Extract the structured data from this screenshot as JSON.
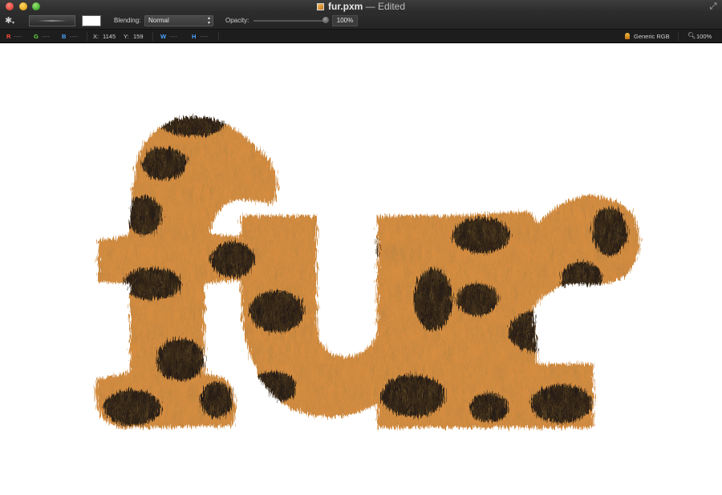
{
  "window": {
    "file_name": "fur.pxm",
    "separator": "—",
    "status": "Edited"
  },
  "toolbar": {
    "blending_label": "Blending:",
    "blending_value": "Normal",
    "opacity_label": "Opacity:",
    "opacity_value": "100%",
    "swatch_color": "#ffffff"
  },
  "infobar": {
    "r_label": "R",
    "g_label": "G",
    "b_label": "B",
    "dash": "----",
    "x_label": "X:",
    "x_value": "1145",
    "y_label": "Y:",
    "y_value": "159",
    "w_label": "W",
    "h_label": "H",
    "color_profile": "Generic RGB",
    "zoom": "100%"
  },
  "canvas": {
    "text": "fur",
    "fill_style": "leopard fur",
    "colors": {
      "fur_base": "#c77a2e",
      "fur_light": "#e4a55a",
      "spots": "#1a1410"
    }
  },
  "icons": {
    "gear": "gear-icon",
    "fullscreen": "fullscreen-icon",
    "profile": "color-profile-icon",
    "zoom": "magnifier-icon"
  }
}
